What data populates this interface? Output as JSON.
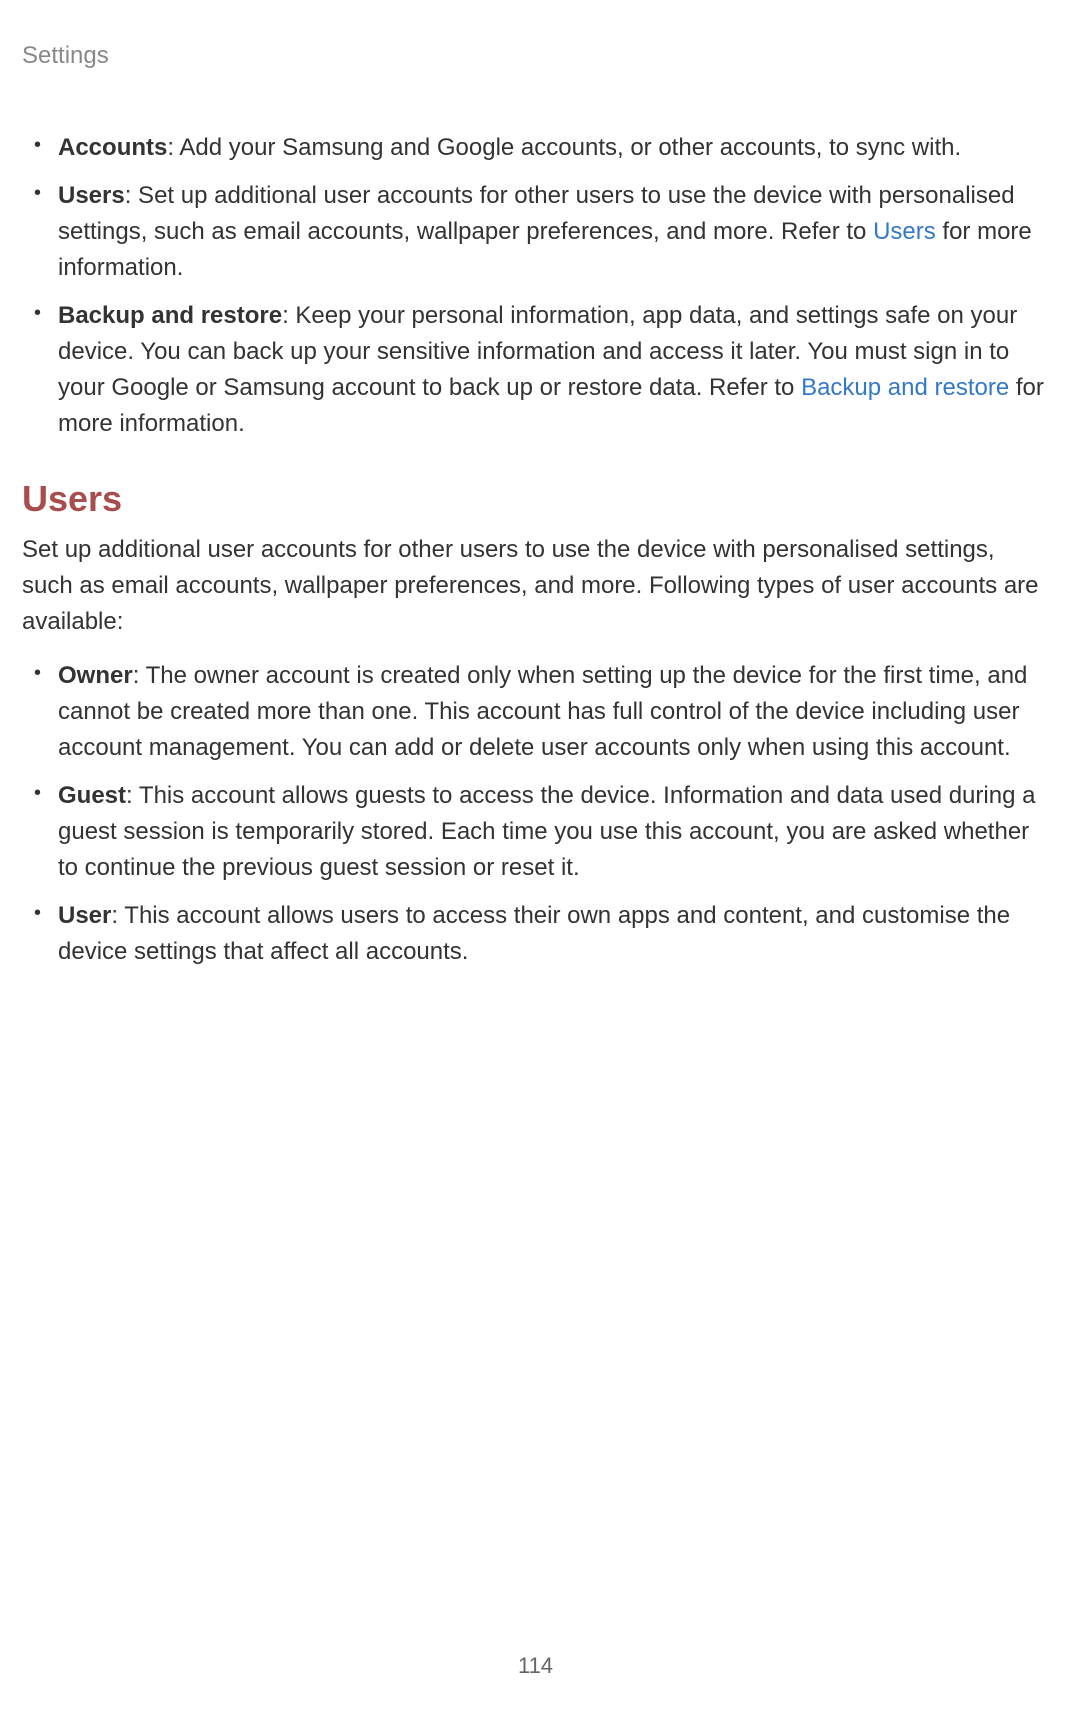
{
  "header": {
    "title": "Settings"
  },
  "topList": {
    "items": [
      {
        "label": "Accounts",
        "text": ": Add your Samsung and Google accounts, or other accounts, to sync with."
      },
      {
        "label": "Users",
        "textBefore": ": Set up additional user accounts for other users to use the device with personalised settings, such as email accounts, wallpaper preferences, and more. Refer to ",
        "link": "Users",
        "textAfter": " for more information."
      },
      {
        "label": "Backup and restore",
        "textBefore": ": Keep your personal information, app data, and settings safe on your device. You can back up your sensitive information and access it later. You must sign in to your Google or Samsung account to back up or restore data. Refer to ",
        "link": "Backup and restore",
        "textAfter": " for more information."
      }
    ]
  },
  "section": {
    "heading": "Users",
    "intro": "Set up additional user accounts for other users to use the device with personalised settings, such as email accounts, wallpaper preferences, and more. Following types of user accounts are available:",
    "items": [
      {
        "label": "Owner",
        "text": ": The owner account is created only when setting up the device for the first time, and cannot be created more than one. This account has full control of the device including user account management. You can add or delete user accounts only when using this account."
      },
      {
        "label": "Guest",
        "text": ": This account allows guests to access the device. Information and data used during a guest session is temporarily stored. Each time you use this account, you are asked whether to continue the previous guest session or reset it."
      },
      {
        "label": "User",
        "text": ": This account allows users to access their own apps and content, and customise the device settings that affect all accounts."
      }
    ]
  },
  "pageNumber": "114"
}
